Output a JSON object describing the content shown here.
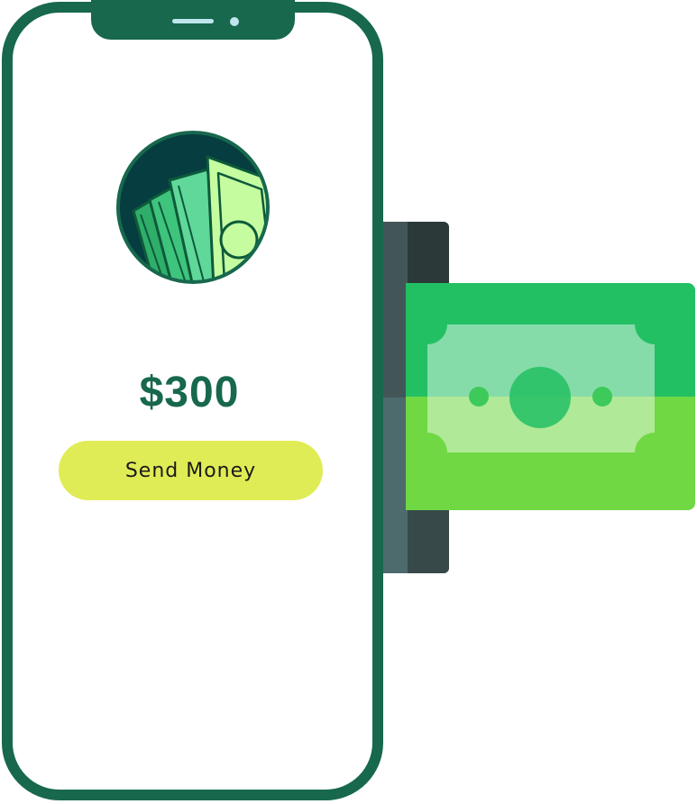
{
  "app": {
    "amount": "$300",
    "send_button_label": "Send Money"
  },
  "colors": {
    "phone_frame": "#17684d",
    "accent_button": "#e0ec55",
    "bill_top": "#22c063",
    "bill_bottom": "#6fd843",
    "logo_background": "#053d40",
    "logo_bill_light": "#c5fca0"
  },
  "icons": {
    "logo": "money-bills-icon",
    "bill": "dollar-bill-icon"
  }
}
